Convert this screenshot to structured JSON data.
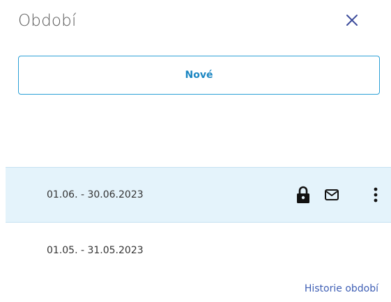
{
  "header": {
    "title": "Období",
    "close_icon": "close-icon"
  },
  "actions": {
    "new_label": "Nové"
  },
  "periods": [
    {
      "label": "01.06. - 30.06.2023",
      "selected": true,
      "locked": true,
      "icons": [
        "lock-icon",
        "mail-icon",
        "more-vertical-icon"
      ]
    },
    {
      "label": "01.05. - 31.05.2023",
      "selected": false,
      "locked": false,
      "icons": []
    }
  ],
  "footer": {
    "history_link": "Historie období"
  },
  "colors": {
    "accent": "#1b86c2",
    "button_border": "#2a9fd6",
    "selected_row_bg": "#e4f3fb",
    "close_icon": "#3a4a9a",
    "link": "#3f5fb5"
  }
}
